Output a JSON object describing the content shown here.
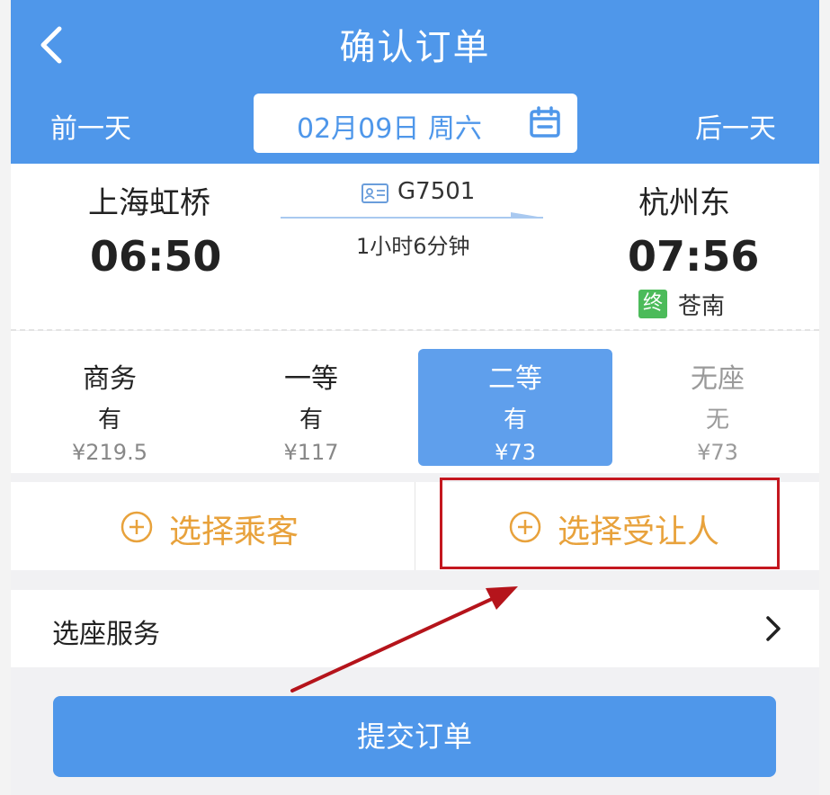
{
  "header": {
    "title": "确认订单",
    "prev_day": "前一天",
    "next_day": "后一天",
    "date": "02月09日 周六",
    "back_icon": "chevron-left-icon",
    "calendar_icon": "calendar-icon",
    "bg_color": "#4f97ea"
  },
  "train": {
    "from_station": "上海虹桥",
    "from_time": "06:50",
    "to_station": "杭州东",
    "to_time": "07:56",
    "train_no": "G7501",
    "duration": "1小时6分钟",
    "terminal_badge": "终",
    "terminal_station": "苍南"
  },
  "seats": [
    {
      "name": "商务",
      "availability": "有",
      "price": "¥219.5",
      "state": "normal"
    },
    {
      "name": "一等",
      "availability": "有",
      "price": "¥117",
      "state": "normal"
    },
    {
      "name": "二等",
      "availability": "有",
      "price": "¥73",
      "state": "selected"
    },
    {
      "name": "无座",
      "availability": "无",
      "price": "¥73",
      "state": "disabled"
    }
  ],
  "choose": {
    "passenger_label": "选择乘客",
    "transferee_label": "选择受让人",
    "accent_color": "#e8a23c"
  },
  "service": {
    "label": "选座服务"
  },
  "submit": {
    "label": "提交订单"
  },
  "annotation": {
    "highlight_color": "#c4171f"
  }
}
